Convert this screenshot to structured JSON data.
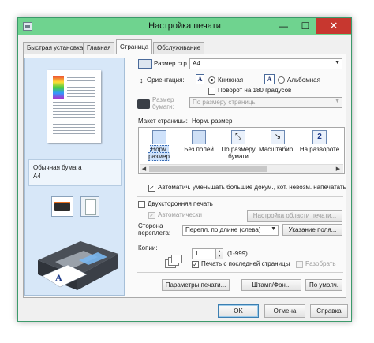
{
  "window": {
    "title": "Настройка печати",
    "close_glyph": "✕",
    "min_glyph": "—",
    "max_glyph": "☐"
  },
  "tabs": [
    {
      "label": "Быстрая установка"
    },
    {
      "label": "Главная"
    },
    {
      "label": "Страница"
    },
    {
      "label": "Обслуживание"
    }
  ],
  "active_tab": "Страница",
  "preview": {
    "paper_type": "Обычная бумага",
    "paper_size": "A4"
  },
  "page_size": {
    "label": "Размер стр.:",
    "value": "A4"
  },
  "orientation": {
    "label": "Ориентация:",
    "portrait_glyph": "A",
    "portrait": "Книжная",
    "landscape_glyph": "A",
    "landscape": "Альбомная",
    "rotate_180": "Поворот на 180 градусов"
  },
  "printer_paper": {
    "label_line1": "Размер",
    "label_line2": "бумаги:",
    "value": "По размеру страницы"
  },
  "page_layout": {
    "label": "Макет страницы:",
    "value": "Норм. размер",
    "items": [
      {
        "line1": "Норм.",
        "line2": "размер",
        "selected": true
      },
      {
        "line1": "Без полей",
        "line2": "",
        "selected": false
      },
      {
        "line1": "По размеру",
        "line2": "бумаги",
        "selected": false
      },
      {
        "line1": "Масштабир...",
        "line2": "",
        "selected": false
      },
      {
        "line1": "На развороте",
        "line2": "",
        "selected": false
      }
    ],
    "item_glyphs": [
      "",
      "",
      "⤡",
      "↘",
      "2"
    ]
  },
  "auto_reduce": "Автоматич. уменьшать большие докум., кот. невозм. напечатать",
  "duplex": {
    "label": "Двухсторонняя печать",
    "auto_label": "Автоматически",
    "area_button": "Настройка области печати..."
  },
  "binding": {
    "label_line1": "Сторона",
    "label_line2": "переплета:",
    "value": "Перепл. по длине (слева)",
    "margin_button": "Указание поля..."
  },
  "copies": {
    "label": "Копии:",
    "value": "1",
    "range": "(1-999)",
    "print_from_last": "Печать с последней страницы",
    "collate": "Разобрать"
  },
  "bottom_buttons": {
    "print_options": "Параметры печати...",
    "stamp": "Штамп/Фон...",
    "defaults": "По умолч."
  },
  "dialog_buttons": {
    "ok": "OK",
    "cancel": "Отмена",
    "help": "Справка"
  },
  "colors": {
    "title_bar": "#6fd38f",
    "close": "#c7372f",
    "preview_bg": "#d7e7f8"
  }
}
